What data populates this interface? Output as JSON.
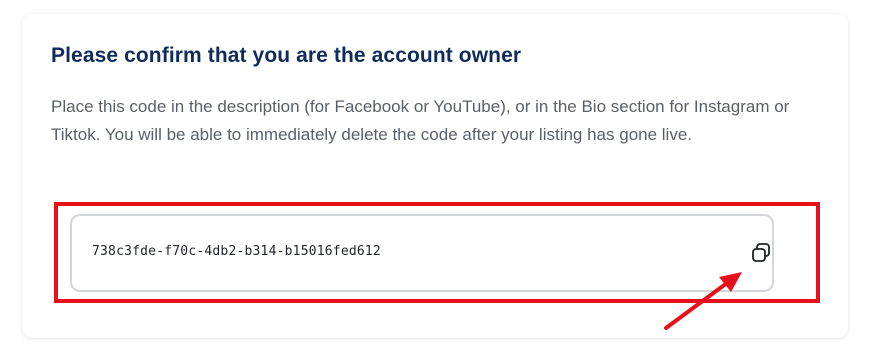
{
  "card": {
    "title": "Please confirm that you are the account owner",
    "description": "Place this code in the description (for Facebook or YouTube), or in the Bio section for Instagram or Tiktok. You will be able to immediately delete the code after your listing has gone live.",
    "code": "738c3fde-f70c-4db2-b314-b15016fed612",
    "copy_icon": "copy-icon"
  },
  "annotation": {
    "highlight_color": "#e8111b",
    "arrow_color": "#e8111b"
  },
  "colors": {
    "title": "#0f2d5c",
    "text": "#595f69",
    "border": "#d2d5da"
  }
}
